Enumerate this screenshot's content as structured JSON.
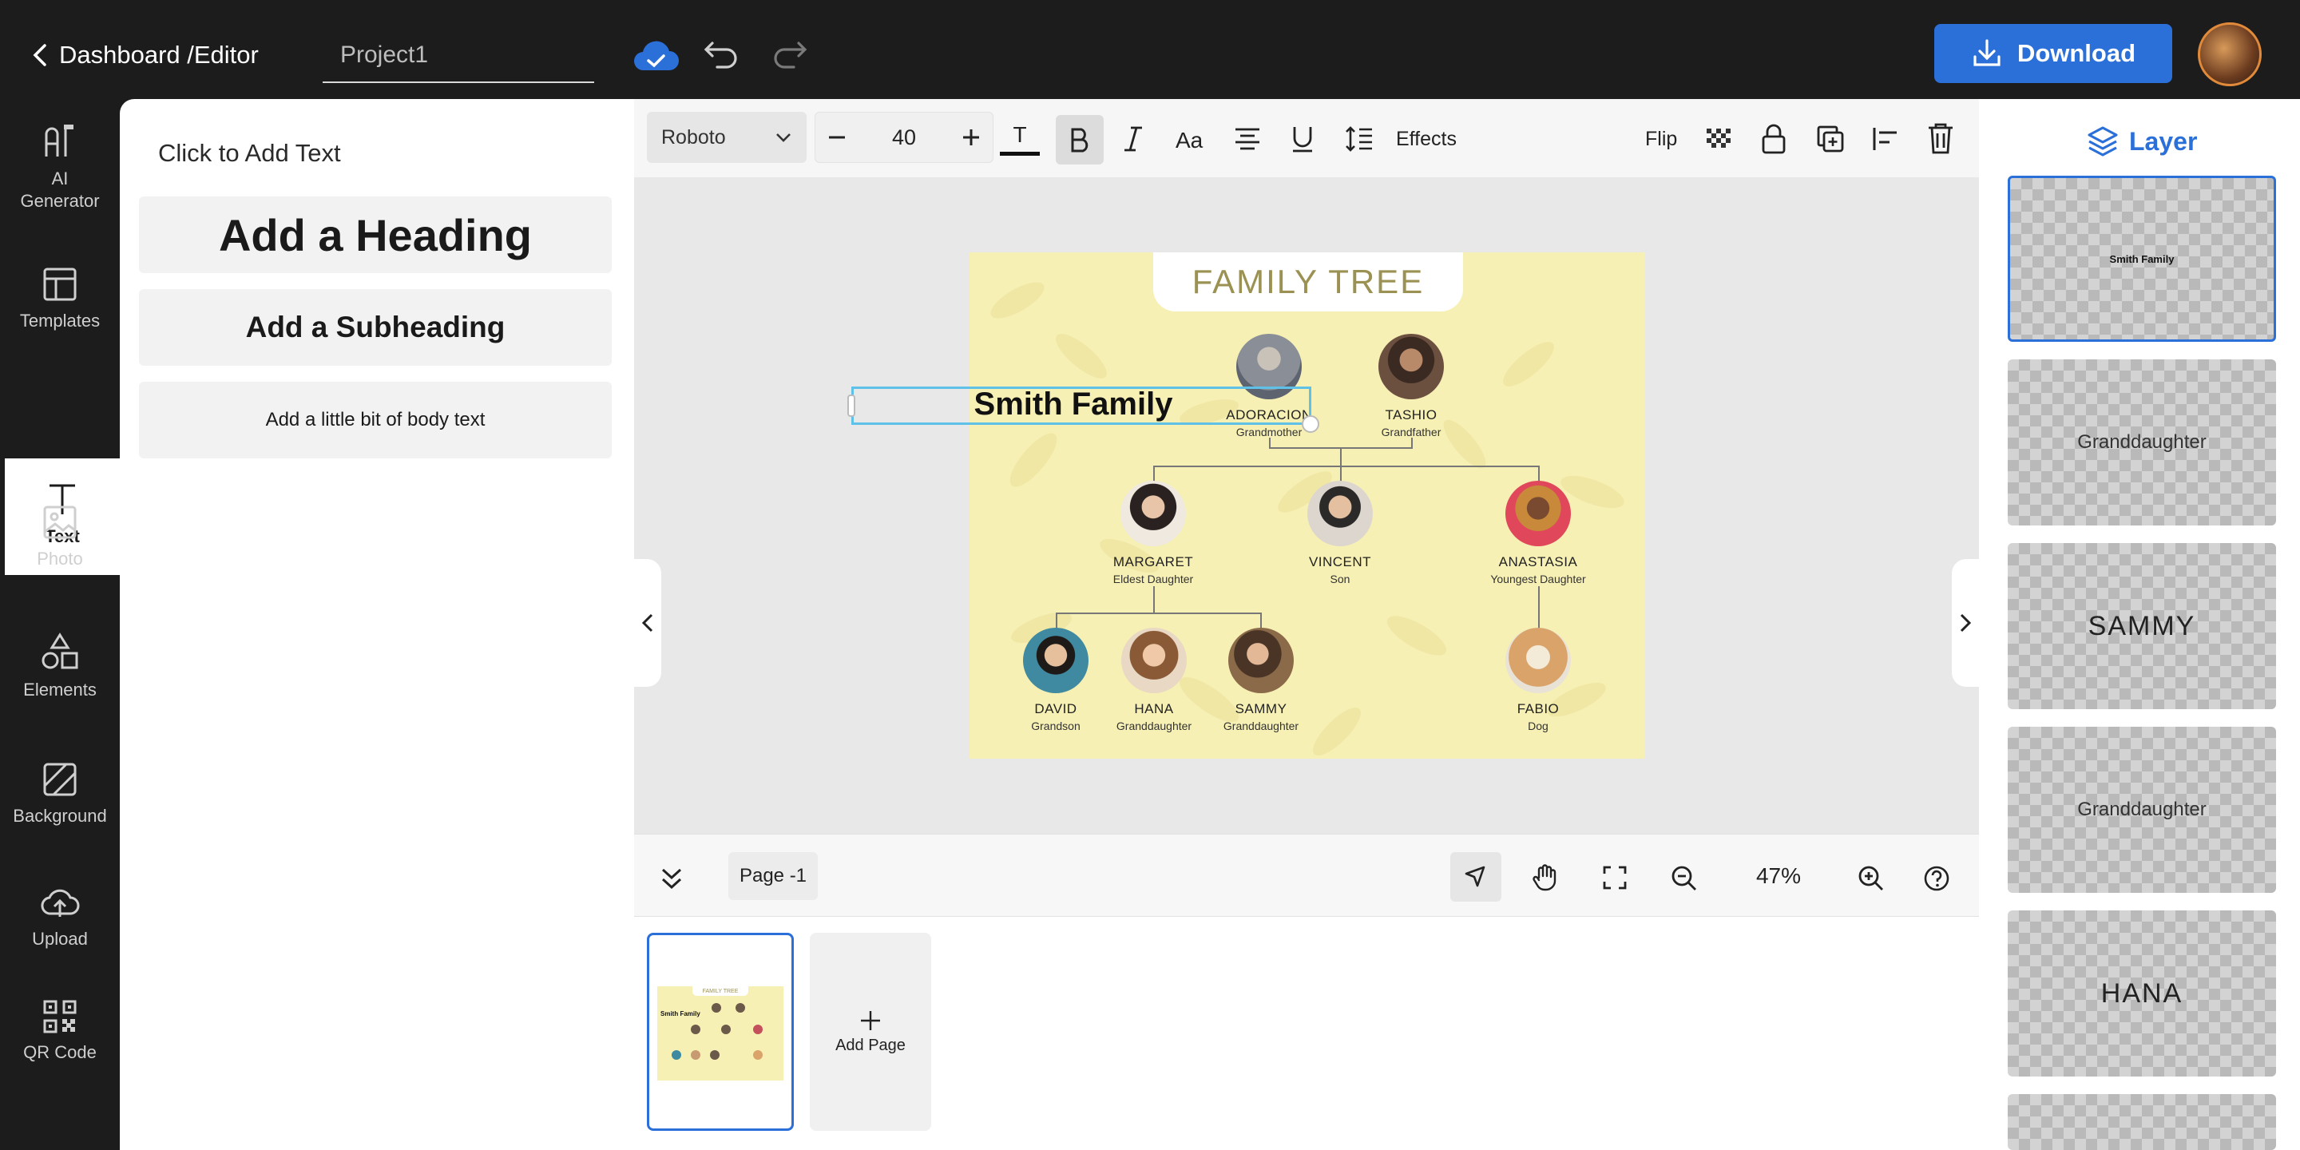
{
  "header": {
    "breadcrumb": "Dashboard /Editor",
    "project_name": "Project1",
    "download_label": "Download"
  },
  "nav": {
    "items": [
      {
        "label": "AI\nGenerator",
        "line1": "AI",
        "line2": "Generator"
      },
      {
        "label": "Templates"
      },
      {
        "label": "Text"
      },
      {
        "label": "Photo"
      },
      {
        "label": "Elements"
      },
      {
        "label": "Background"
      },
      {
        "label": "Upload"
      },
      {
        "label": "QR Code"
      }
    ]
  },
  "text_panel": {
    "hint": "Click to Add Text",
    "heading": "Add a Heading",
    "subheading": "Add a Subheading",
    "body": "Add a little bit of body text"
  },
  "toolbar": {
    "font": "Roboto",
    "font_size": "40",
    "effects": "Effects",
    "flip": "Flip"
  },
  "design": {
    "title": "FAMILY TREE",
    "selected_text": "Smith Family",
    "people": [
      {
        "name": "ADORACION",
        "role": "Grandmother",
        "color": "#8a8e96"
      },
      {
        "name": "TASHIO",
        "role": "Grandfather",
        "color": "#6b5040"
      },
      {
        "name": "MARGARET",
        "role": "Eldest Daughter",
        "color": "#c9a38a"
      },
      {
        "name": "VINCENT",
        "role": "Son",
        "color": "#d6cfc7"
      },
      {
        "name": "ANASTASIA",
        "role": "Youngest Daughter",
        "color": "#e0475a"
      },
      {
        "name": "DAVID",
        "role": "Grandson",
        "color": "#3f8aa0"
      },
      {
        "name": "HANA",
        "role": "Granddaughter",
        "color": "#d8b48f"
      },
      {
        "name": "SAMMY",
        "role": "Granddaughter",
        "color": "#8a6a48"
      },
      {
        "name": "FABIO",
        "role": "Dog",
        "color": "#d9a36a"
      }
    ]
  },
  "pagebar": {
    "page_label": "Page -1",
    "zoom": "47%",
    "add_page": "Add Page"
  },
  "thumbnail": {
    "title": "FAMILY TREE",
    "text": "Smith Family"
  },
  "layers": {
    "title": "Layer",
    "items": [
      "Smith Family",
      "Granddaughter",
      "SAMMY",
      "Granddaughter",
      "HANA"
    ]
  },
  "colors": {
    "accent": "#2b6fd8",
    "dark": "#1c1c1d",
    "design_bg": "#f7f0b4",
    "selection": "#5fc0e8"
  }
}
